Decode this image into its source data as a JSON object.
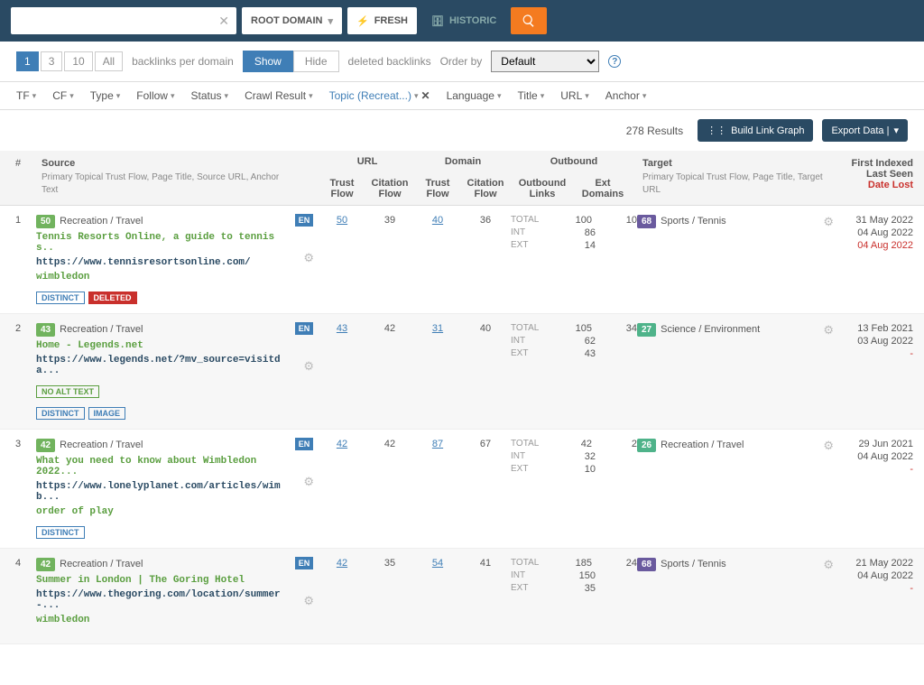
{
  "topbar": {
    "root_domain": "ROOT DOMAIN",
    "fresh": "FRESH",
    "historic": "HISTORIC"
  },
  "controls": {
    "nums": [
      "1",
      "3",
      "10",
      "All"
    ],
    "per_domain": "backlinks per domain",
    "show": "Show",
    "hide": "Hide",
    "deleted": "deleted backlinks",
    "order_by": "Order by",
    "order_val": "Default"
  },
  "filters": [
    "TF",
    "CF",
    "Type",
    "Follow",
    "Status",
    "Crawl Result"
  ],
  "topic_filter": "Topic (Recreat...)",
  "filters2": [
    "Language",
    "Title",
    "URL",
    "Anchor"
  ],
  "results": {
    "count": "278 Results",
    "build": "Build Link Graph",
    "export": "Export Data |"
  },
  "headers": {
    "idx": "#",
    "source": "Source",
    "src_desc": "Primary Topical Trust Flow, Page Title, Source URL, Anchor Text",
    "url": "URL",
    "domain": "Domain",
    "outbound": "Outbound",
    "tf": "Trust Flow",
    "cf": "Citation Flow",
    "olinks": "Outbound Links",
    "edom": "Ext Domains",
    "target": "Target",
    "tgt_desc": "Primary Topical Trust Flow, Page Title, Target URL",
    "fi": "First Indexed",
    "ls": "Last Seen",
    "dl": "Date Lost"
  },
  "rows": [
    {
      "idx": "1",
      "score": "50",
      "scoreColor": "#71b35e",
      "topic": "Recreation / Travel",
      "title": "Tennis Resorts Online, a guide to tennis s..",
      "url": "https://www.tennisresortsonline.com/",
      "anchor": "wimbledon",
      "pills": [
        {
          "t": "DISTINCT",
          "c": ""
        },
        {
          "t": "DELETED",
          "c": "del"
        }
      ],
      "lang": "EN",
      "utf": "50",
      "ucf": "39",
      "dtf": "40",
      "dcf": "36",
      "out": {
        "total": [
          "100",
          "10"
        ],
        "int": "86",
        "ext": "14"
      },
      "tscore": "68",
      "tcolor": "#6a5a9e",
      "ttopic": "Sports / Tennis",
      "d1": "31 May 2022",
      "d2": "04 Aug 2022",
      "d3": "04 Aug 2022"
    },
    {
      "idx": "2",
      "score": "43",
      "scoreColor": "#71b35e",
      "topic": "Recreation / Travel",
      "title": "Home - Legends.net",
      "url": "https://www.legends.net/?mv_source=visitda...",
      "anchor": "",
      "noalt": "NO ALT TEXT",
      "pills": [
        {
          "t": "DISTINCT",
          "c": ""
        },
        {
          "t": "IMAGE",
          "c": ""
        }
      ],
      "lang": "EN",
      "utf": "43",
      "ucf": "42",
      "dtf": "31",
      "dcf": "40",
      "out": {
        "total": [
          "105",
          "34"
        ],
        "int": "62",
        "ext": "43"
      },
      "tscore": "27",
      "tcolor": "#4fb38a",
      "ttopic": "Science / Environment",
      "d1": "13 Feb 2021",
      "d2": "03 Aug 2022",
      "d3": "-"
    },
    {
      "idx": "3",
      "score": "42",
      "scoreColor": "#71b35e",
      "topic": "Recreation / Travel",
      "title": "What you need to know about Wimbledon 2022...",
      "url": "https://www.lonelyplanet.com/articles/wimb...",
      "anchor": "order of play",
      "pills": [
        {
          "t": "DISTINCT",
          "c": ""
        }
      ],
      "lang": "EN",
      "utf": "42",
      "ucf": "42",
      "dtf": "87",
      "dcf": "67",
      "out": {
        "total": [
          "42",
          "2"
        ],
        "int": "32",
        "ext": "10"
      },
      "tscore": "26",
      "tcolor": "#4fb38a",
      "ttopic": "Recreation / Travel",
      "d1": "29 Jun 2021",
      "d2": "04 Aug 2022",
      "d3": "-"
    },
    {
      "idx": "4",
      "score": "42",
      "scoreColor": "#71b35e",
      "topic": "Recreation / Travel",
      "title": "Summer in London | The Goring Hotel",
      "url": "https://www.thegoring.com/location/summer-...",
      "anchor": "wimbledon",
      "pills": [],
      "lang": "EN",
      "utf": "42",
      "ucf": "35",
      "dtf": "54",
      "dcf": "41",
      "out": {
        "total": [
          "185",
          "24"
        ],
        "int": "150",
        "ext": "35"
      },
      "tscore": "68",
      "tcolor": "#6a5a9e",
      "ttopic": "Sports / Tennis",
      "d1": "21 May 2022",
      "d2": "04 Aug 2022",
      "d3": "-"
    }
  ],
  "labels": {
    "total": "TOTAL",
    "int": "INT",
    "ext": "EXT"
  }
}
